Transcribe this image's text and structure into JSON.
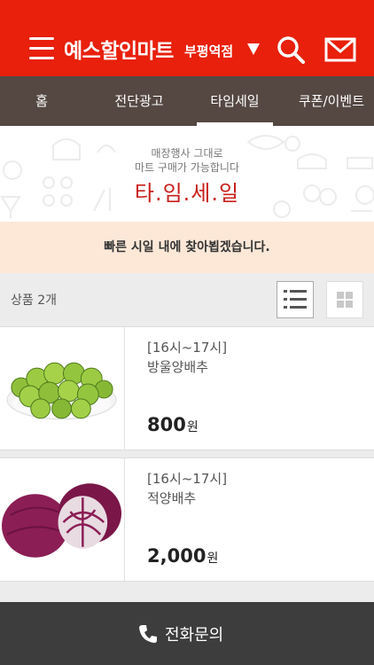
{
  "header": {
    "title": "예스할인마트",
    "branch": "부평역점",
    "icons": {
      "menu": "menu-icon",
      "dropdown": "triangle-down-icon",
      "search": "search-icon",
      "mail": "mail-icon"
    },
    "colors": {
      "brand": "#e8200c",
      "tab_bar": "#554843"
    }
  },
  "tabs": [
    {
      "label": "홈",
      "active": false
    },
    {
      "label": "전단광고",
      "active": false
    },
    {
      "label": "타임세일",
      "active": true
    },
    {
      "label": "쿠폰/이벤트",
      "active": false
    }
  ],
  "banner": {
    "line1": "매장행사 그대로",
    "line2": "마트 구매가 가능합니다",
    "title": "타.임.세.일",
    "title_color": "#c8201c"
  },
  "notice": {
    "text": "빠른 시일 내에 찾아뵙겠습니다."
  },
  "list": {
    "count_label": "상품 2개",
    "view_modes": {
      "list": "list-view-icon",
      "grid": "grid-view-icon"
    }
  },
  "products": [
    {
      "time": "[16시~17시]",
      "name": "방울양배추",
      "price": "800",
      "unit": "원",
      "image": "brussels-sprouts-image"
    },
    {
      "time": "[16시~17시]",
      "name": "적양배추",
      "price": "2,000",
      "unit": "원",
      "image": "red-cabbage-image"
    }
  ],
  "footer": {
    "label": "전화문의",
    "icon": "phone-icon"
  }
}
